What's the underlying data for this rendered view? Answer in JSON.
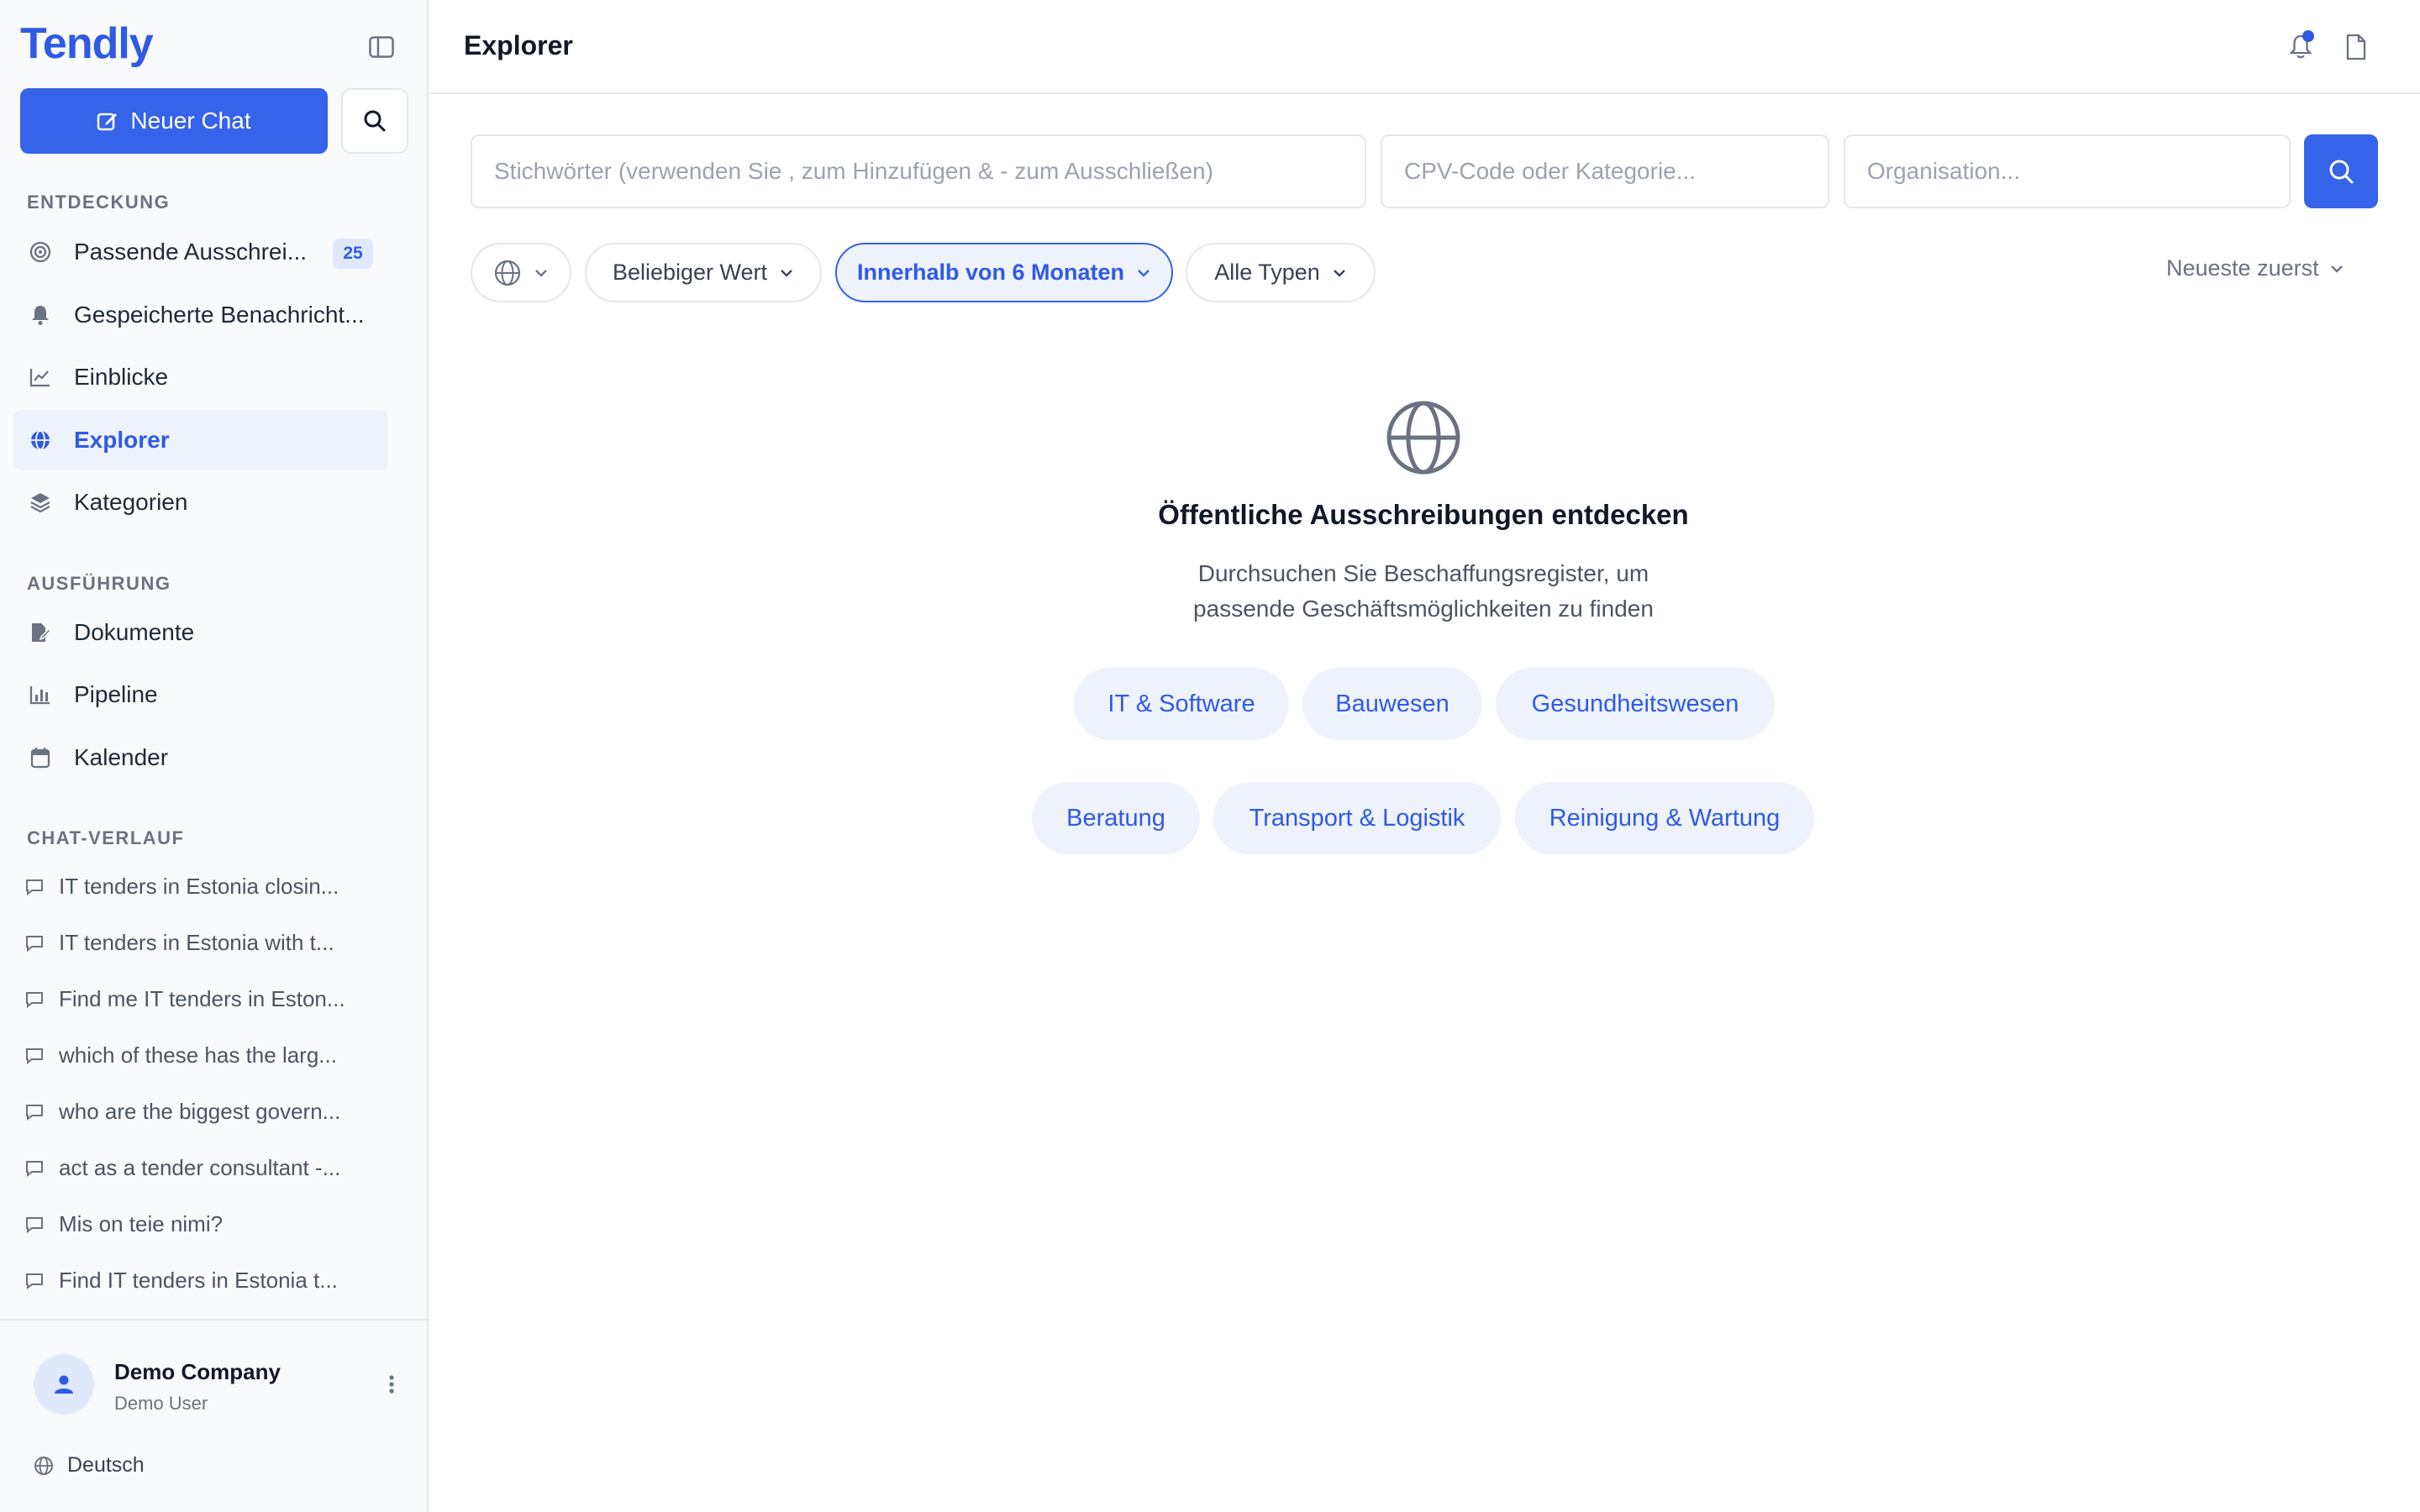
{
  "app": {
    "logo": "Tendly",
    "new_chat_label": "Neuer Chat"
  },
  "sidebar": {
    "sections": {
      "discovery": "ENTDECKUNG",
      "execution": "AUSFÜHRUNG",
      "chat_history": "CHAT-VERLAUF"
    },
    "discovery_items": [
      {
        "label": "Passende Ausschrei...",
        "badge": "25",
        "icon": "target-icon"
      },
      {
        "label": "Gespeicherte Benachricht...",
        "icon": "bell-icon"
      },
      {
        "label": "Einblicke",
        "icon": "line-chart-icon"
      },
      {
        "label": "Explorer",
        "icon": "globe-icon",
        "active": true
      },
      {
        "label": "Kategorien",
        "icon": "layers-icon"
      }
    ],
    "execution_items": [
      {
        "label": "Dokumente",
        "icon": "document-edit-icon"
      },
      {
        "label": "Pipeline",
        "icon": "bar-chart-icon"
      },
      {
        "label": "Kalender",
        "icon": "calendar-icon"
      }
    ],
    "chats": [
      "IT tenders in Estonia closin...",
      "IT tenders in Estonia with t...",
      "Find me IT tenders in Eston...",
      "which of these has the larg...",
      "who are the biggest govern...",
      "act as a tender consultant -...",
      "Mis on teie nimi?",
      "Find IT tenders in Estonia t..."
    ],
    "user": {
      "company": "Demo Company",
      "role": "Demo User"
    },
    "language": "Deutsch"
  },
  "header": {
    "title": "Explorer"
  },
  "search": {
    "keywords_placeholder": "Stichwörter (verwenden Sie , zum Hinzufügen & - zum Ausschließen)",
    "cpv_placeholder": "CPV-Code oder Kategorie...",
    "org_placeholder": "Organisation..."
  },
  "filters": {
    "value": "Beliebiger Wert",
    "timeframe": "Innerhalb von 6 Monaten",
    "type": "Alle Typen",
    "sort": "Neueste zuerst"
  },
  "empty_state": {
    "title": "Öffentliche Ausschreibungen entdecken",
    "description_line1": "Durchsuchen Sie Beschaffungsregister, um",
    "description_line2": "passende Geschäftsmöglichkeiten zu finden",
    "categories": [
      "IT & Software",
      "Bauwesen",
      "Gesundheitswesen",
      "Beratung",
      "Transport & Logistik",
      "Reinigung & Wartung"
    ]
  },
  "colors": {
    "accent": "#3563e9",
    "accent_text": "#2f5ae6",
    "accent_soft": "#eef2fb"
  }
}
